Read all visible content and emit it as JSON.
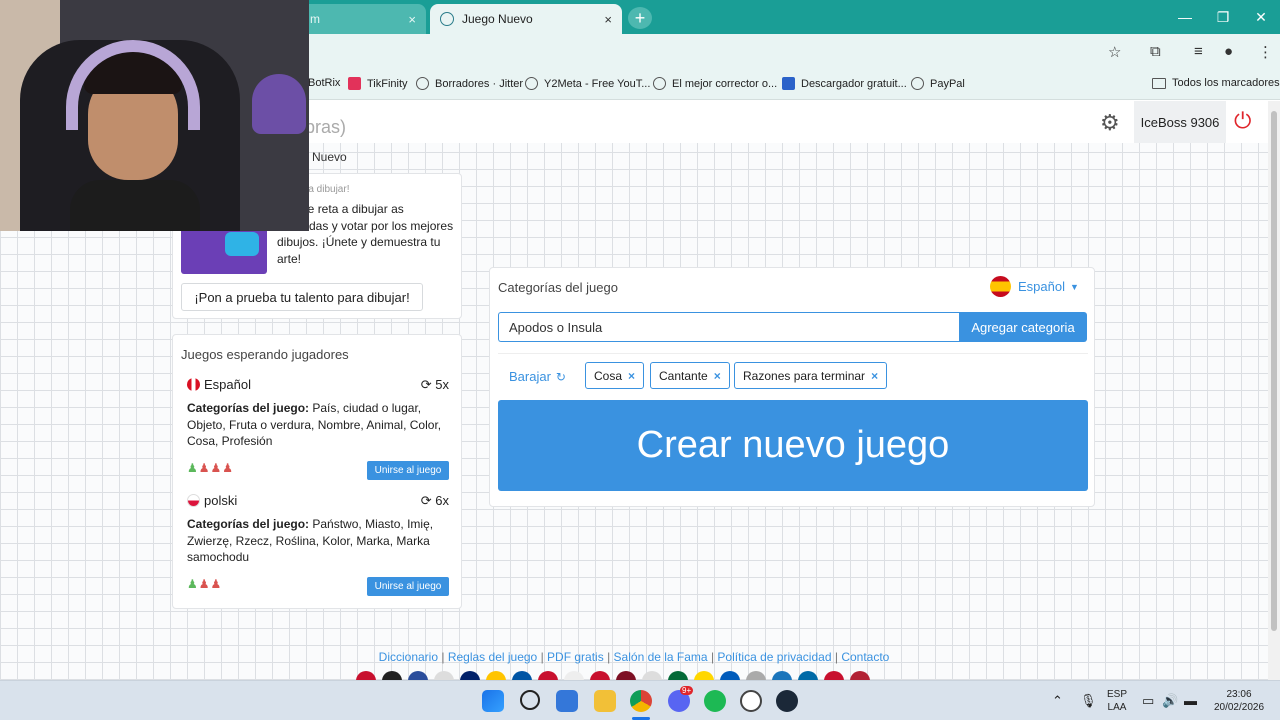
{
  "browser": {
    "tabs": [
      {
        "title": "m",
        "active": false
      },
      {
        "title": "Juego Nuevo",
        "active": true
      }
    ],
    "tab_close_glyph": "×",
    "new_tab_glyph": "+",
    "window_controls": [
      "—",
      "❐",
      "✕"
    ],
    "bookmarks": [
      {
        "label": "BotRix",
        "icon": "bookmark-icon"
      },
      {
        "label": "TikFinity",
        "icon": "tikfinity-icon"
      },
      {
        "label": "Borradores · Jitter",
        "icon": "globe-icon"
      },
      {
        "label": "Y2Meta - Free YouT...",
        "icon": "globe-icon"
      },
      {
        "label": "El mejor corrector o...",
        "icon": "globe-icon"
      },
      {
        "label": "Descargador gratuit...",
        "icon": "downloader-icon"
      },
      {
        "label": "PayPal",
        "icon": "globe-icon"
      }
    ],
    "all_bookmarks_label": "Todos los marcadores"
  },
  "header": {
    "site_title_fragment": "bras)",
    "username": "IceBoss 9306"
  },
  "breadcrumb": "Nuevo",
  "promo": {
    "heading": "ra dibujar!",
    "text": "Best te reta a dibujar as divertidas y votar por los mejores dibujos. ¡Únete y demuestra tu arte!",
    "button_label": "¡Pon a prueba tu talento para dibujar!"
  },
  "waiting_games": {
    "title": "Juegos esperando jugadores",
    "categories_label": "Categorías del juego:",
    "join_label": "Unirse al juego",
    "games": [
      {
        "language": "Español",
        "rounds": "5x",
        "categories": "País, ciudad o lugar, Objeto, Fruta o verdura, Nombre, Animal, Color, Cosa, Profesión",
        "players_joined": 1,
        "players_total": 4
      },
      {
        "language": "polski",
        "rounds": "6x",
        "categories": "Państwo, Miasto, Imię, Zwierzę, Rzecz, Roślina, Kolor, Marka, Marka samochodu",
        "players_joined": 1,
        "players_total": 3
      }
    ]
  },
  "new_game": {
    "categories_title": "Categorías del juego",
    "language": "Español",
    "input_value": "Apodos o Insula",
    "add_button_label": "Agregar categoria",
    "shuffle_label": "Barajar",
    "chips": [
      "Cosa",
      "Cantante",
      "Razones para terminar"
    ],
    "create_button_label": "Crear nuevo juego"
  },
  "footer": {
    "links": [
      "Diccionario",
      "Reglas del juego",
      "PDF gratis",
      "Salón de la Fama",
      "Política de privacidad",
      "Contacto"
    ],
    "separator": "|"
  },
  "taskbar": {
    "lang_line1": "ESP",
    "lang_line2": "LAA",
    "time": "23:06",
    "date": "20/02/2026",
    "discord_badge": "9+"
  },
  "colors": {
    "accent": "#3a92e0",
    "tabbar": "#1a9e96",
    "power": "#e0252b"
  }
}
